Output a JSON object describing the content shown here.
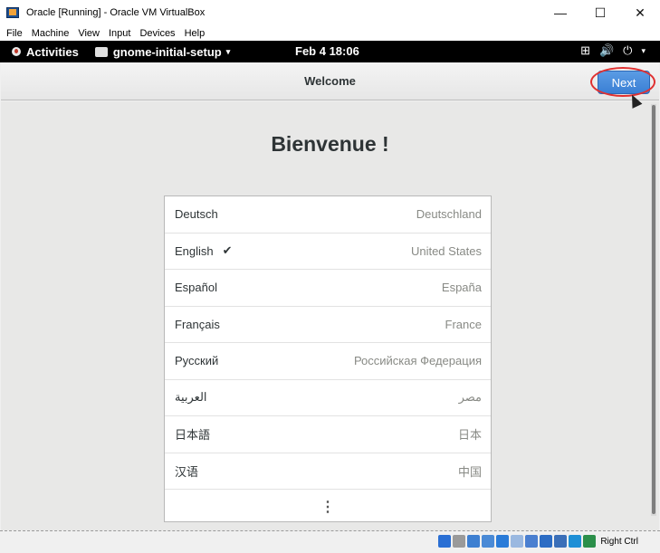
{
  "window": {
    "title": "Oracle [Running] - Oracle VM VirtualBox",
    "controls": {
      "minimize": "—",
      "maximize": "☐",
      "close": "✕"
    }
  },
  "vbox_menu": [
    "File",
    "Machine",
    "View",
    "Input",
    "Devices",
    "Help"
  ],
  "gnome_topbar": {
    "activities": "Activities",
    "app_menu": "gnome-initial-setup",
    "clock": "Feb 4  18:06",
    "network_glyph": "⊞",
    "volume_glyph": "🔊",
    "power_glyph": "⏻",
    "caret": "▾"
  },
  "headerbar": {
    "title": "Welcome",
    "next_label": "Next"
  },
  "main": {
    "heading": "Bienvenue !",
    "languages": [
      {
        "name": "Deutsch",
        "region": "Deutschland",
        "selected": false
      },
      {
        "name": "English",
        "region": "United States",
        "selected": true
      },
      {
        "name": "Español",
        "region": "España",
        "selected": false
      },
      {
        "name": "Français",
        "region": "France",
        "selected": false
      },
      {
        "name": "Русский",
        "region": "Российская Федерация",
        "selected": false
      },
      {
        "name": "العربية",
        "region": "مصر",
        "selected": false
      },
      {
        "name": "日本語",
        "region": "日本",
        "selected": false
      },
      {
        "name": "汉语",
        "region": "中国",
        "selected": false
      }
    ],
    "check_glyph": "✔",
    "more_glyph": "⋮"
  },
  "statusbar": {
    "host_key": "Right Ctrl",
    "icon_colors": [
      "#2a6fd4",
      "#9a9a9a",
      "#3d7fd1",
      "#4a8ad6",
      "#2a7bd8",
      "#9ab8e0",
      "#4a7fd0",
      "#2c6cc4",
      "#3b6fb8",
      "#1e8fd6",
      "#2b8f4a"
    ]
  },
  "colors": {
    "accent": "#3a7fd4",
    "highlight_ring": "#e03030"
  }
}
